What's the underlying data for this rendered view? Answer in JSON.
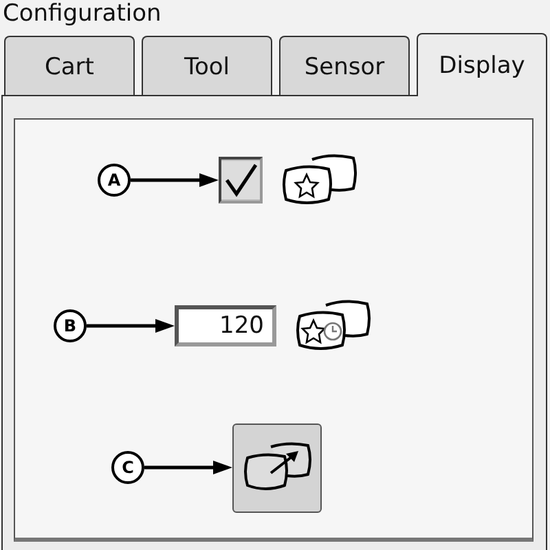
{
  "window": {
    "title": "Configuration"
  },
  "tabs": [
    {
      "label": "Cart",
      "selected": false
    },
    {
      "label": "Tool",
      "selected": false
    },
    {
      "label": "Sensor",
      "selected": false
    },
    {
      "label": "Display",
      "selected": true
    }
  ],
  "settings": [
    {
      "kind": "checkbox",
      "callout": "A",
      "checked": true
    },
    {
      "kind": "number",
      "callout": "B",
      "value": "120"
    },
    {
      "kind": "button",
      "callout": "C"
    }
  ]
}
